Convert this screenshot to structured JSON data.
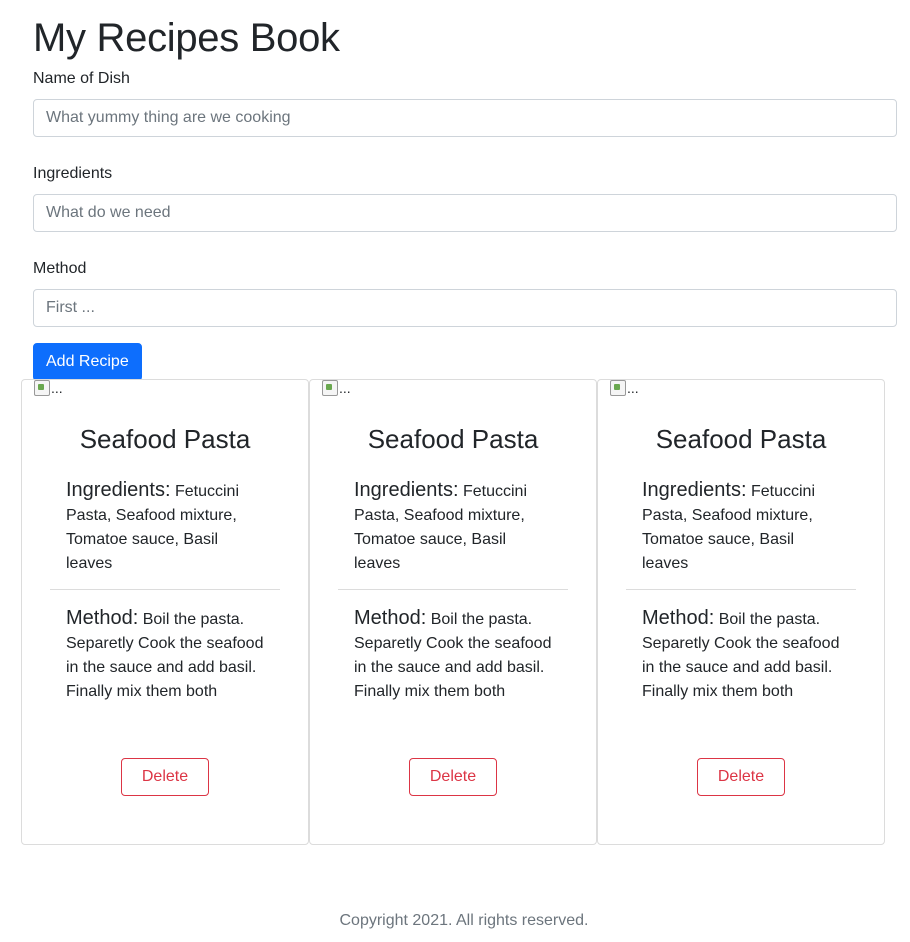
{
  "page": {
    "title": "My Recipes Book"
  },
  "form": {
    "name_label": "Name of Dish",
    "name_placeholder": "What yummy thing are we cooking",
    "ingredients_label": "Ingredients",
    "ingredients_placeholder": "What do we need",
    "method_label": "Method",
    "method_placeholder": "First ...",
    "submit_label": "Add Recipe"
  },
  "cards": [
    {
      "img_alt": "...",
      "title": "Seafood Pasta",
      "ingredients_heading": "Ingredients:",
      "ingredients": "Fetuccini Pasta, Seafood mixture, Tomatoe sauce, Basil leaves",
      "method_heading": "Method:",
      "method": "Boil the pasta. Separetly Cook the seafood in the sauce and add basil. Finally mix them both",
      "delete_label": "Delete"
    },
    {
      "img_alt": "...",
      "title": "Seafood Pasta",
      "ingredients_heading": "Ingredients:",
      "ingredients": "Fetuccini Pasta, Seafood mixture, Tomatoe sauce, Basil leaves",
      "method_heading": "Method:",
      "method": "Boil the pasta. Separetly Cook the seafood in the sauce and add basil. Finally mix them both",
      "delete_label": "Delete"
    },
    {
      "img_alt": "...",
      "title": "Seafood Pasta",
      "ingredients_heading": "Ingredients:",
      "ingredients": "Fetuccini Pasta, Seafood mixture, Tomatoe sauce, Basil leaves",
      "method_heading": "Method:",
      "method": "Boil the pasta. Separetly Cook the seafood in the sauce and add basil. Finally mix them both",
      "delete_label": "Delete"
    }
  ],
  "footer": {
    "text": "Copyright 2021. All rights reserved."
  },
  "colors": {
    "primary": "#0d6efd",
    "danger": "#dc3545",
    "muted": "#6c757d",
    "border": "#ced4da"
  }
}
